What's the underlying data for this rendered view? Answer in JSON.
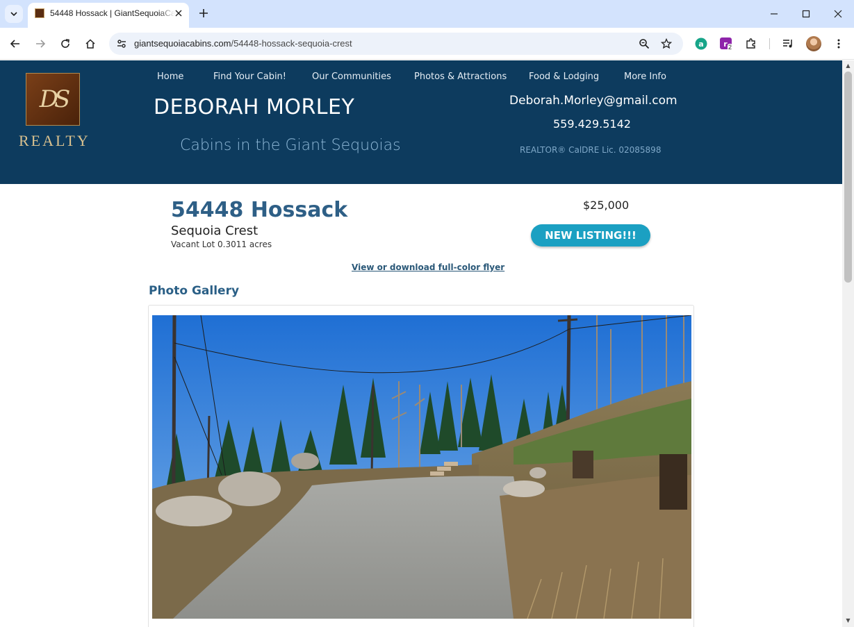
{
  "browser": {
    "tab_title": "54448 Hossack | GiantSequoiaCabins",
    "url_domain": "giantsequoiacabins.com",
    "url_path": "/54448-hossack-sequoia-crest",
    "extension_badge": "2"
  },
  "site": {
    "logo_monogram": "DS",
    "logo_text": "REALTY",
    "nav": [
      "Home",
      "Find Your Cabin!",
      "Our Communities",
      "Photos & Attractions",
      "Food & Lodging",
      "More Info"
    ],
    "agent_name": "DEBORAH MORLEY",
    "tagline": "Cabins in the Giant Sequoias",
    "email": "Deborah.Morley@gmail.com",
    "phone": "559.429.5142",
    "license": "REALTOR® CalDRE Lic. 02085898",
    "header_color": "#0d3b5e"
  },
  "listing": {
    "address": "54448 Hossack",
    "community": "Sequoia Crest",
    "description": "Vacant Lot 0.3011 acres",
    "price": "$25,000",
    "badge": "NEW LISTING!!!",
    "flyer_link": "View or download full-color flyer",
    "gallery_heading": "Photo Gallery",
    "photo_alt": "Paved driveway on a sloped lot with pines, boulders and utility poles under blue sky"
  }
}
